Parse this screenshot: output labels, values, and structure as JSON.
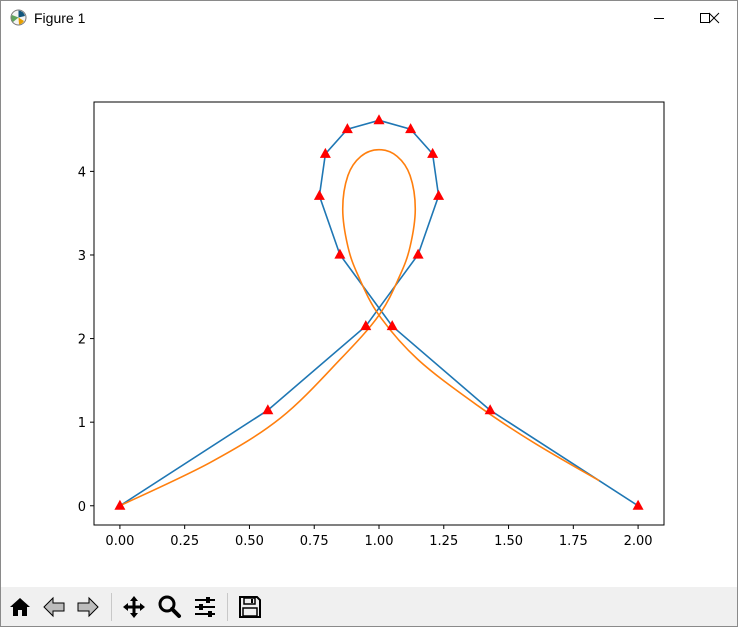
{
  "window": {
    "title": "Figure 1",
    "icon": "matplotlib-icon",
    "controls": [
      "minimize-icon",
      "maximize-icon",
      "close-icon"
    ]
  },
  "chart_data": {
    "type": "line",
    "title": "",
    "xlabel": "",
    "ylabel": "",
    "xlim": [
      -0.1,
      2.1
    ],
    "ylim": [
      -0.23,
      4.83
    ],
    "xticks": [
      "0.00",
      "0.25",
      "0.50",
      "0.75",
      "1.00",
      "1.25",
      "1.50",
      "1.75",
      "2.00"
    ],
    "yticks": [
      "0",
      "1",
      "2",
      "3",
      "4"
    ],
    "grid": false,
    "legend": "none",
    "series": [
      {
        "color": "#1f77b4",
        "marker": "red-triangle",
        "points": [
          [
            0.0,
            0.0
          ],
          [
            0.571,
            1.143
          ],
          [
            0.949,
            2.149
          ],
          [
            1.151,
            3.004
          ],
          [
            1.23,
            3.707
          ],
          [
            1.207,
            4.209
          ],
          [
            1.122,
            4.505
          ],
          [
            1.0,
            4.611
          ],
          [
            0.878,
            4.505
          ],
          [
            0.793,
            4.209
          ],
          [
            0.77,
            3.707
          ],
          [
            0.849,
            3.004
          ],
          [
            1.051,
            2.149
          ],
          [
            1.429,
            1.143
          ],
          [
            2.0,
            0.0
          ]
        ]
      },
      {
        "color": "#ff7f0e",
        "marker": "none",
        "points": [
          [
            0.0,
            0.0
          ],
          [
            0.35,
            0.52
          ],
          [
            0.62,
            1.05
          ],
          [
            0.85,
            1.75
          ],
          [
            1.0,
            2.28
          ],
          [
            1.08,
            2.75
          ],
          [
            1.12,
            3.1
          ],
          [
            1.14,
            3.55
          ],
          [
            1.12,
            3.95
          ],
          [
            1.07,
            4.18
          ],
          [
            1.0,
            4.26
          ],
          [
            0.93,
            4.18
          ],
          [
            0.88,
            3.95
          ],
          [
            0.86,
            3.55
          ],
          [
            0.88,
            3.1
          ],
          [
            0.92,
            2.75
          ],
          [
            1.0,
            2.28
          ],
          [
            1.15,
            1.75
          ],
          [
            1.38,
            1.2
          ],
          [
            1.6,
            0.75
          ],
          [
            1.85,
            0.3
          ]
        ]
      }
    ]
  },
  "toolbar": {
    "buttons": [
      "home-icon",
      "back-icon",
      "forward-icon",
      "pan-icon",
      "zoom-icon",
      "configure-subplots-icon",
      "save-icon"
    ]
  }
}
